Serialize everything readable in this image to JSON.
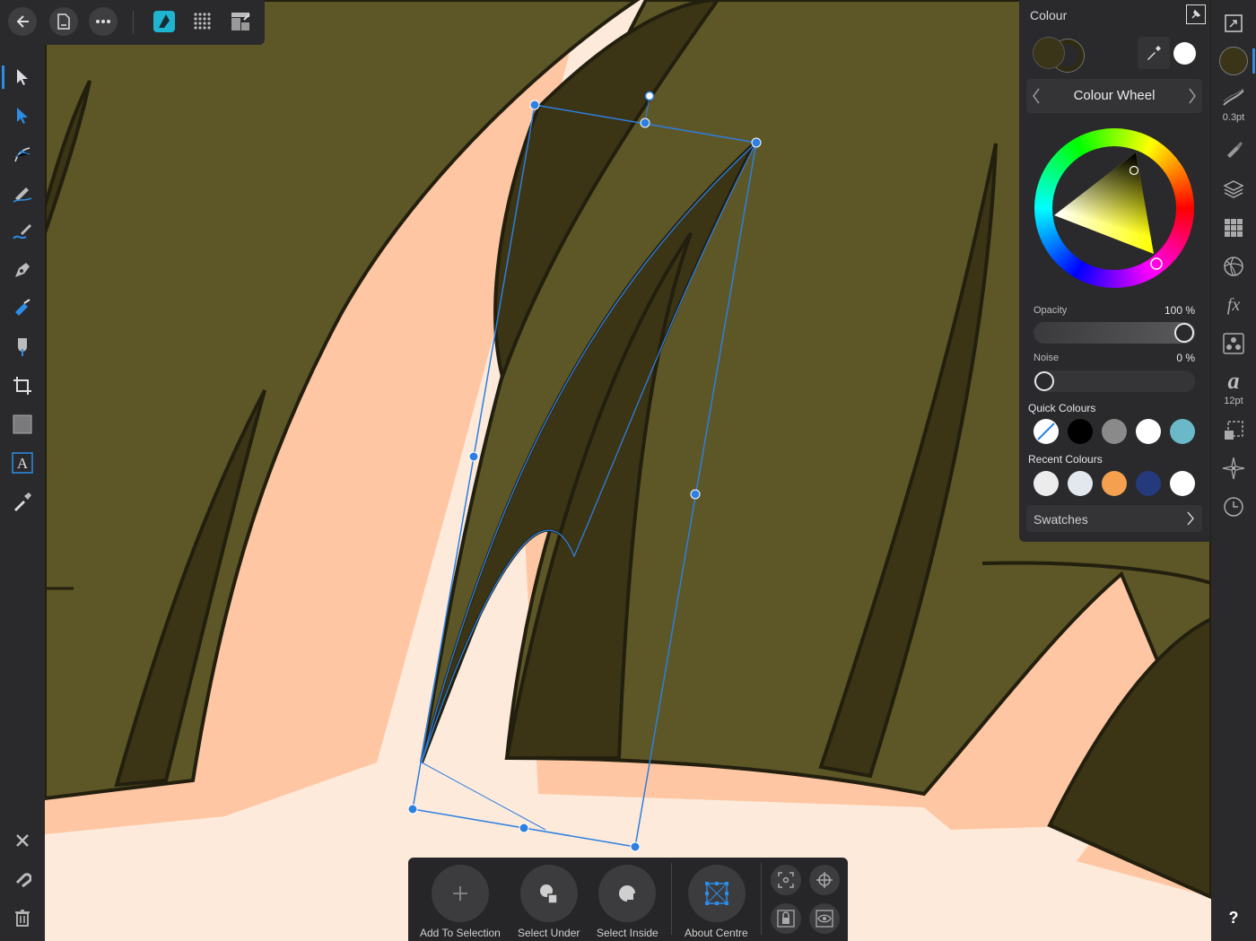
{
  "colour_panel": {
    "title": "Colour",
    "mode": "Colour Wheel",
    "opacity_label": "Opacity",
    "opacity_value": "100 %",
    "opacity_fraction": 1.0,
    "noise_label": "Noise",
    "noise_value": "0 %",
    "noise_fraction": 0.0,
    "quick_colours_label": "Quick Colours",
    "quick_colours": [
      "none",
      "#000000",
      "#8a8a8a",
      "#ffffff",
      "#6bb8c9"
    ],
    "recent_colours_label": "Recent Colours",
    "recent_colours": [
      "#ececec",
      "#e3e8ef",
      "#f5a04e",
      "#243a7a",
      "#ffffff"
    ],
    "swatches_label": "Swatches",
    "fill_colour": "#3a3418",
    "stroke_colour": "#ffffff"
  },
  "studio": {
    "stroke_width": "0.3pt",
    "font_size": "12pt",
    "icons": [
      "canvas-icon",
      "colour-icon",
      "stroke-icon",
      "brush-icon",
      "layers-icon",
      "swatches-icon",
      "appearance-icon",
      "fx-icon",
      "styles-icon",
      "text-styles-icon",
      "transform-icon",
      "navigator-icon",
      "history-icon",
      "help-icon"
    ],
    "help_glyph": "?"
  },
  "context_toolbar": {
    "add_to_selection": "Add To Selection",
    "select_under": "Select Under",
    "select_inside": "Select Inside",
    "about_centre": "About Centre"
  },
  "top_toolbar": {
    "icons": [
      "back-icon",
      "document-icon",
      "more-icon",
      "designer-persona-icon",
      "pixel-persona-icon",
      "export-persona-icon"
    ]
  },
  "left_tools": {
    "icons": [
      "move-tool-icon",
      "node-tool-icon",
      "corner-tool-icon",
      "pencil-tool-icon",
      "vector-brush-tool-icon",
      "pen-tool-icon",
      "fill-tool-icon",
      "transparency-tool-icon",
      "artboard-tool-icon",
      "shape-tool-icon",
      "text-tool-icon",
      "colour-picker-icon",
      "close-icon",
      "snapping-icon",
      "delete-icon"
    ]
  },
  "colors": {
    "hair_olive": "#5d5626",
    "hair_dark": "#3b3415",
    "skin_light": "#fdeadb",
    "skin_peach": "#fec6a2",
    "outline": "#231f0f",
    "selection_blue": "#2d7fe0"
  }
}
